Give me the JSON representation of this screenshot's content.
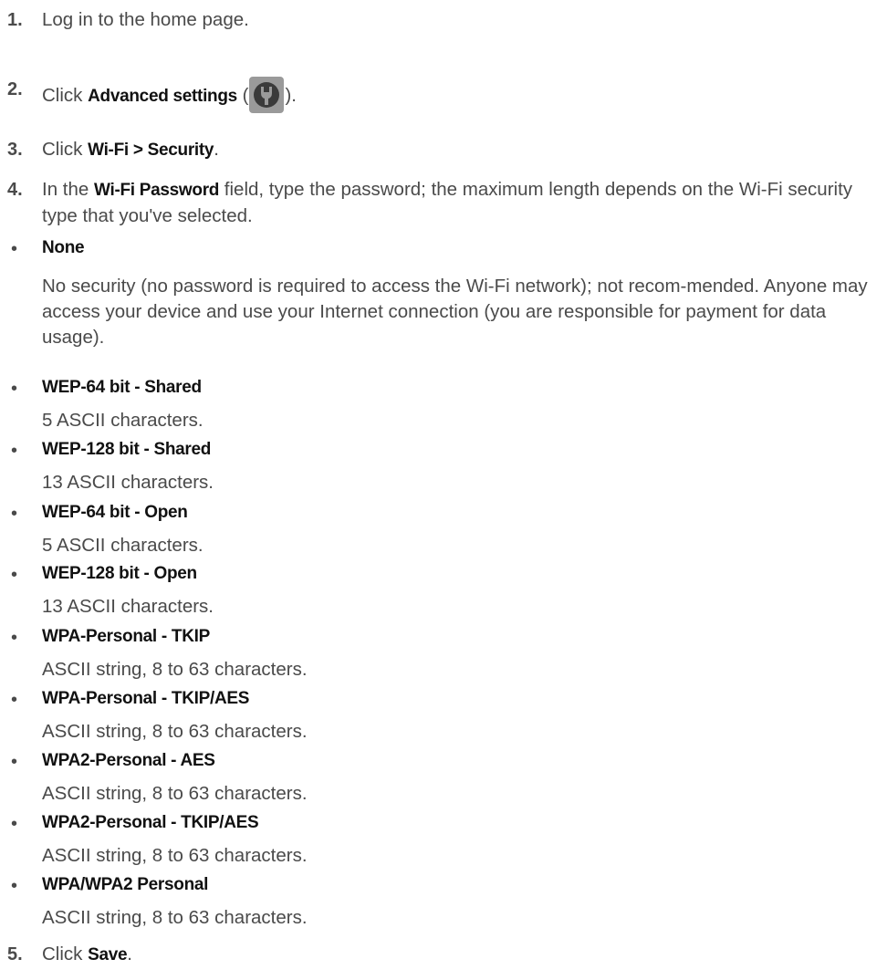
{
  "steps": {
    "s1": {
      "num": "1.",
      "text": "Log in to the home page."
    },
    "s2": {
      "num": "2.",
      "pre": "Click ",
      "bold": "Advanced settings",
      "open": " (",
      "close": ")."
    },
    "s3": {
      "num": "3.",
      "pre": "Click ",
      "bold": "Wi-Fi > Security",
      "post": "."
    },
    "s4": {
      "num": "4.",
      "pre": "In the ",
      "bold": "Wi-Fi Password",
      "post": " field, type the password; the maximum length depends on the Wi-Fi security type that you've selected."
    },
    "s5": {
      "num": "5.",
      "pre": "Click ",
      "bold": "Save",
      "post": "."
    }
  },
  "bullet_char": "•",
  "security_types": [
    {
      "name": "None",
      "desc": "No security (no password is required to access the Wi-Fi network); not recom-mended. Anyone may access your device and use your Internet connection (you are responsible for payment for data usage)."
    },
    {
      "name": "WEP-64 bit - Shared",
      "desc": "5 ASCII characters."
    },
    {
      "name": "WEP-128 bit - Shared",
      "desc": "13 ASCII characters."
    },
    {
      "name": "WEP-64 bit - Open",
      "desc": "5 ASCII characters."
    },
    {
      "name": "WEP-128 bit - Open",
      "desc": "13 ASCII characters."
    },
    {
      "name": "WPA-Personal - TKIP",
      "desc": "ASCII string, 8 to 63 characters."
    },
    {
      "name": "WPA-Personal - TKIP/AES",
      "desc": "ASCII string, 8 to 63 characters."
    },
    {
      "name": "WPA2-Personal - AES",
      "desc": "ASCII string, 8 to 63 characters."
    },
    {
      "name": "WPA2-Personal - TKIP/AES",
      "desc": "ASCII string, 8 to 63 characters."
    },
    {
      "name": "WPA/WPA2 Personal",
      "desc": "ASCII string, 8 to 63 characters."
    }
  ],
  "icons": {
    "advanced_settings": "wrench-icon"
  },
  "colors": {
    "body_text": "#4a4a4a",
    "emphasis": "#111111",
    "icon_bg": "#9a9a9a"
  }
}
